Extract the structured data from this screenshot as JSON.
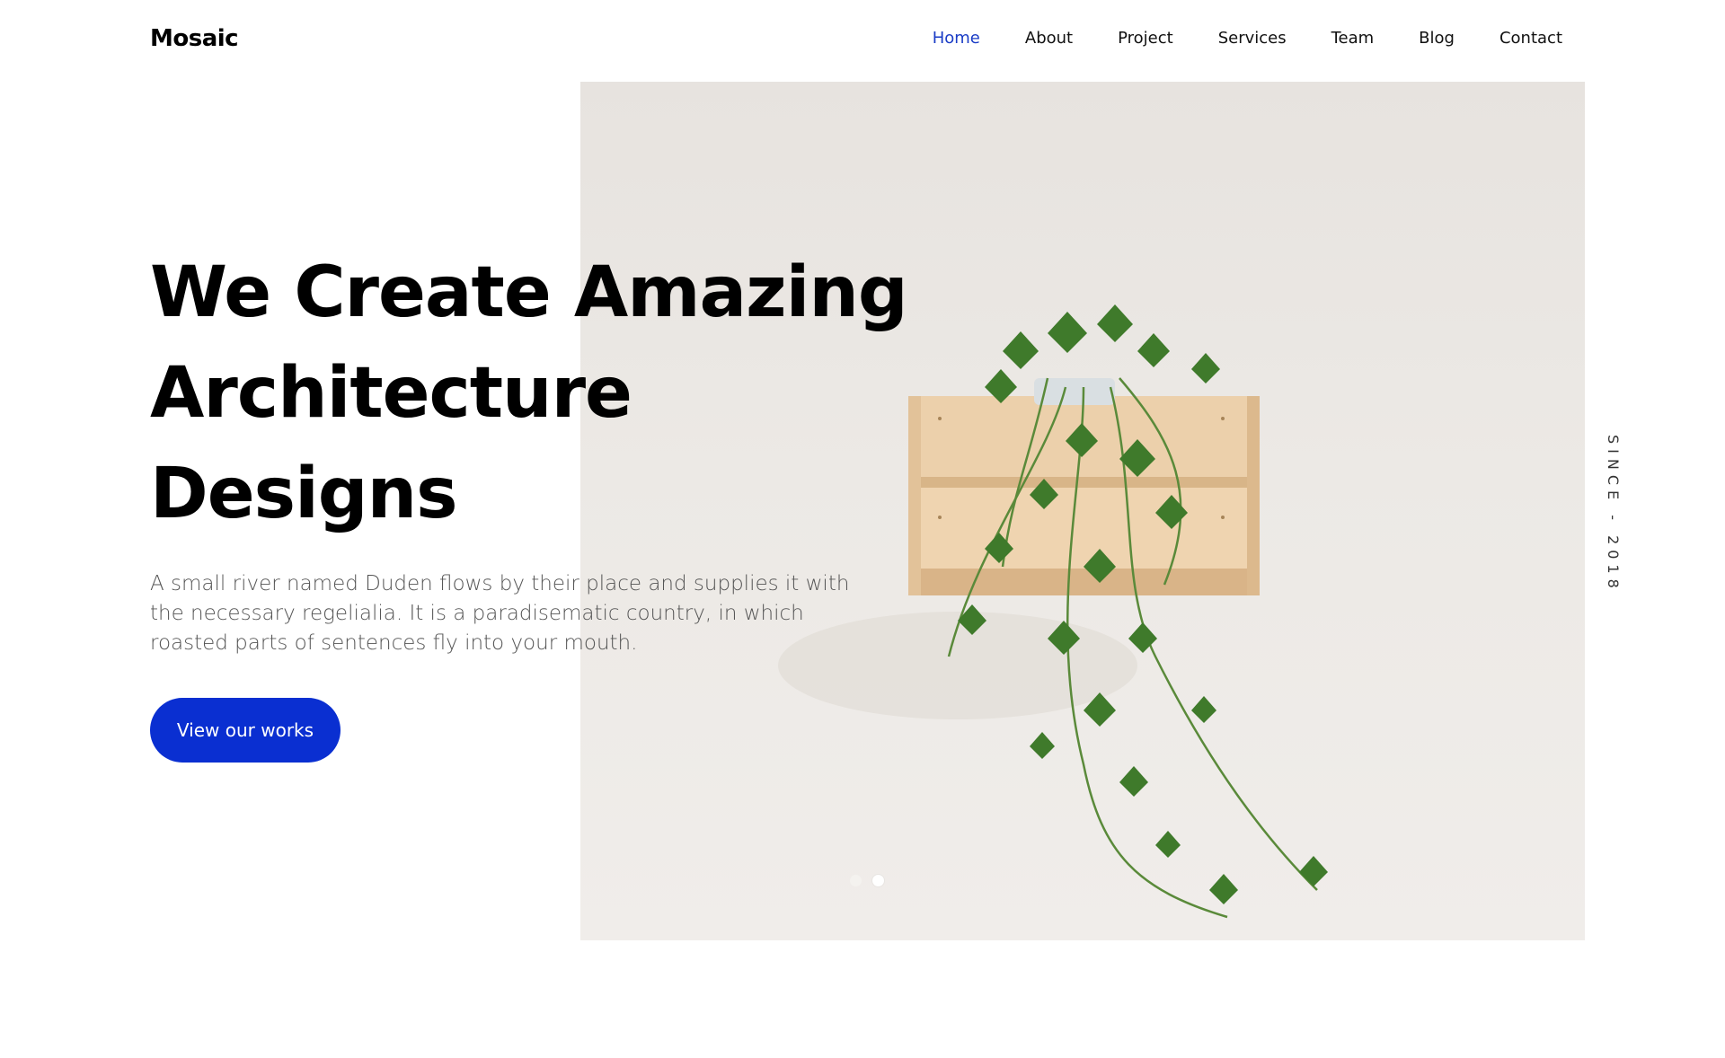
{
  "brand": {
    "logo": "Mosaic"
  },
  "nav": {
    "items": [
      {
        "label": "Home",
        "active": true
      },
      {
        "label": "About"
      },
      {
        "label": "Project"
      },
      {
        "label": "Services"
      },
      {
        "label": "Team"
      },
      {
        "label": "Blog"
      },
      {
        "label": "Contact"
      }
    ]
  },
  "hero": {
    "title_lines": [
      "We Create Amazing",
      "Architecture",
      "Designs"
    ],
    "description": "A small river named Duden flows by their place and supplies it with the necessary regelialia. It is a paradisematic country, in which roasted parts of sentences fly into your mouth.",
    "cta_label": "View our works",
    "side_text": "SINCE - 2018",
    "slides": {
      "count": 2,
      "active_index": 1
    }
  },
  "colors": {
    "accent": "#0a2fd1",
    "nav_active": "#1a3cc6",
    "photo_background": "#ebe7e3",
    "wood": "#e9c9a2",
    "leaf": "#3f7a2b"
  }
}
